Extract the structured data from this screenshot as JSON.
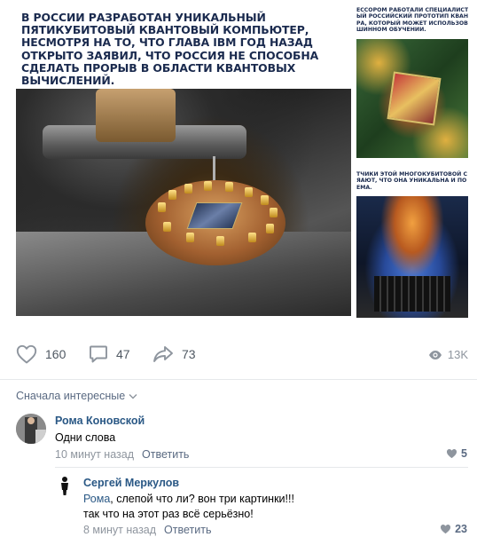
{
  "post": {
    "main_caption": "В России разработан уникальный пятикубитовый квантовый компьютер, несмотря на то, что глава IBM год назад открыто заявил, что Россия не способна сделать прорыв в области квантовых вычислений.",
    "side_top_caption": [
      "ЕССОРОМ РАБОТАЛИ СПЕЦИАЛИСТЫ МС",
      "ЫЙ РОССИЙСКИЙ ПРОТОТИП КВАНТО",
      "РА, КОТОРЫЙ МОЖЕТ ИСПОЛЬЗОВАТЬС",
      "ШИННОМ ОБУЧЕНИИ."
    ],
    "side_bottom_caption": [
      "ТЧИКИ ЭТОЙ МНОГОКУБИТОВОЙ С",
      "ЯАЮТ, ЧТО ОНА УНИКАЛЬНА И ПО",
      "ЕМА."
    ]
  },
  "actions": {
    "likes": "160",
    "comments": "47",
    "shares": "73",
    "views": "13K"
  },
  "comments_section": {
    "sort_label": "Сначала интересные",
    "comments": [
      {
        "author": "Рома Коновской",
        "text": "Одни слова",
        "time": "10 минут назад",
        "reply_label": "Ответить",
        "likes": "5"
      },
      {
        "author": "Сергей Меркулов",
        "mention": "Рома",
        "text_line1": ", слепой что ли? вон три картинки!!!",
        "text_line2": "так что на этот раз всё серьёзно!",
        "time": "8 минут назад",
        "reply_label": "Ответить",
        "likes": "23"
      }
    ]
  },
  "colors": {
    "link": "#2a5885",
    "muted": "#8e959e",
    "icon": "#8e959e",
    "caption": "#1a2a4e"
  }
}
